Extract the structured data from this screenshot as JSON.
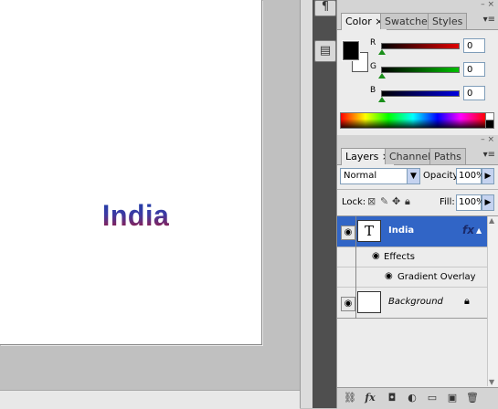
{
  "canvas": {
    "text": "India"
  },
  "color_panel": {
    "tabs": [
      "Color",
      "Swatches",
      "Styles"
    ],
    "close_glyph": "×",
    "sliders": [
      {
        "label": "R",
        "value": "0",
        "gradient_end": "#e00000"
      },
      {
        "label": "G",
        "value": "0",
        "gradient_end": "#00c000"
      },
      {
        "label": "B",
        "value": "0",
        "gradient_end": "#0000e0"
      }
    ]
  },
  "layers_panel": {
    "tabs": [
      "Layers",
      "Channels",
      "Paths"
    ],
    "blend_mode": "Normal",
    "opacity_label": "Opacity:",
    "opacity_value": "100%",
    "lock_label": "Lock:",
    "fill_label": "Fill:",
    "fill_value": "100%",
    "layers": [
      {
        "name": "India",
        "thumb": "T",
        "fx": "fx",
        "selected": true
      },
      {
        "name": "Background",
        "thumb": "",
        "locked": true
      }
    ],
    "effects_label": "Effects",
    "gradient_overlay_label": "Gradient Overlay"
  },
  "colors": {
    "selection": "#3165c6",
    "panel_bg": "#ececec",
    "dock": "#4f4f4f"
  }
}
